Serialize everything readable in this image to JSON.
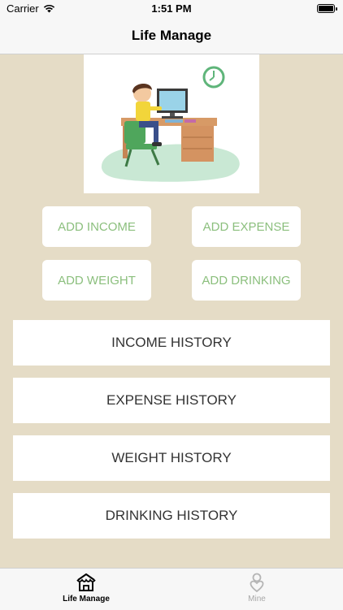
{
  "status": {
    "carrier": "Carrier",
    "time": "1:51 PM"
  },
  "nav": {
    "title": "Life Manage"
  },
  "actions": {
    "add_income": "ADD INCOME",
    "add_expense": "ADD EXPENSE",
    "add_weight": "ADD WEIGHT",
    "add_drinking": "ADD DRINKING"
  },
  "history": {
    "income": "INCOME HISTORY",
    "expense": "EXPENSE HISTORY",
    "weight": "WEIGHT HISTORY",
    "drinking": "DRINKING HISTORY"
  },
  "tabs": [
    {
      "label": "Life Manage",
      "icon": "house-icon",
      "active": true
    },
    {
      "label": "Mine",
      "icon": "person-heart-icon",
      "active": false
    }
  ],
  "colors": {
    "background": "#e5dcc6",
    "accent_green": "#8bbf7d",
    "card": "#ffffff"
  }
}
